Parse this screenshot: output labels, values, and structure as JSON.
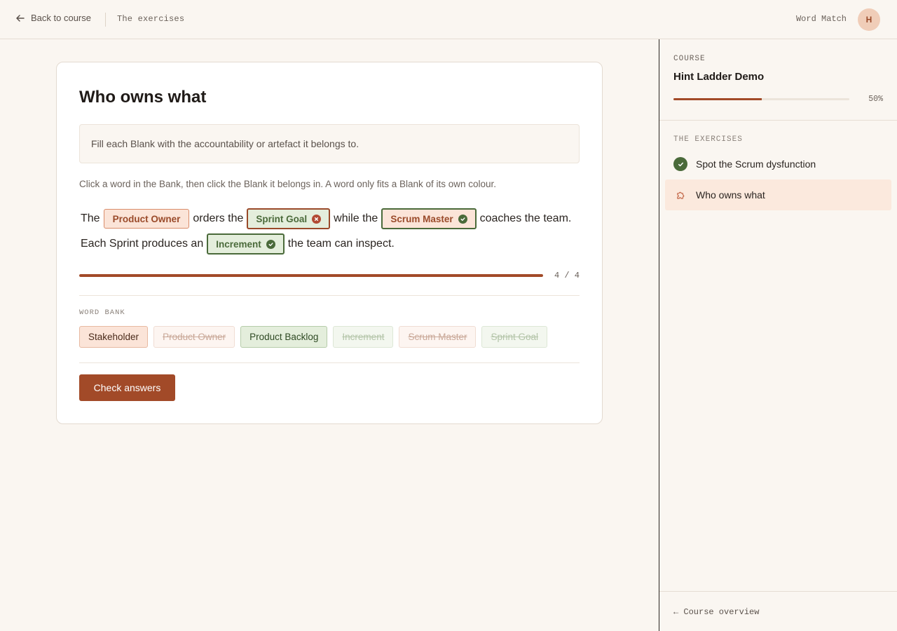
{
  "topbar": {
    "back_label": "Back to course",
    "crumb": "The exercises",
    "mode": "Word Match",
    "avatar_initial": "H"
  },
  "exercise": {
    "title": "Who owns what",
    "instruction": "Fill each Blank with the accountability or artefact it belongs to.",
    "help": "Click a word in the Bank, then click the Blank it belongs in. A word only fits a Blank of its own colour.",
    "sentence1": {
      "w1": "The",
      "blank1": "Product Owner",
      "w2": "orders the",
      "blank2": "Sprint Goal",
      "w3": "while the",
      "blank3": "Scrum Master",
      "w4": "coaches the team."
    },
    "sentence2": {
      "w1": "Each Sprint produces an",
      "blank4": "Increment",
      "w2": "the team can inspect."
    },
    "progress": {
      "filled": 4,
      "total": 4,
      "label": "4 / 4",
      "fraction": 1.0
    },
    "word_bank_label": "WORD BANK",
    "word_bank": [
      {
        "label": "Stakeholder",
        "color": "orange",
        "used": false
      },
      {
        "label": "Product Owner",
        "color": "orange",
        "used": true
      },
      {
        "label": "Product Backlog",
        "color": "green",
        "used": false
      },
      {
        "label": "Increment",
        "color": "green",
        "used": true
      },
      {
        "label": "Scrum Master",
        "color": "orange",
        "used": true
      },
      {
        "label": "Sprint Goal",
        "color": "green",
        "used": true
      }
    ],
    "check_label": "Check answers"
  },
  "sidebar": {
    "course_label": "COURSE",
    "course_title": "Hint Ladder Demo",
    "progress_label": "50%",
    "progress_fraction": 0.5,
    "exercises_label": "THE EXERCISES",
    "items": [
      {
        "label": "Spot the Scrum dysfunction",
        "status": "complete",
        "icon": "check-icon"
      },
      {
        "label": "Who owns what",
        "status": "current",
        "icon": "puzzle-icon"
      }
    ],
    "overview_label": "← Course overview"
  },
  "colors": {
    "accent": "#a24a28",
    "green": "#4a6a3a",
    "orange_bg": "#fbe4d8",
    "green_bg": "#e4eedc",
    "page_bg": "#faf6f1"
  }
}
